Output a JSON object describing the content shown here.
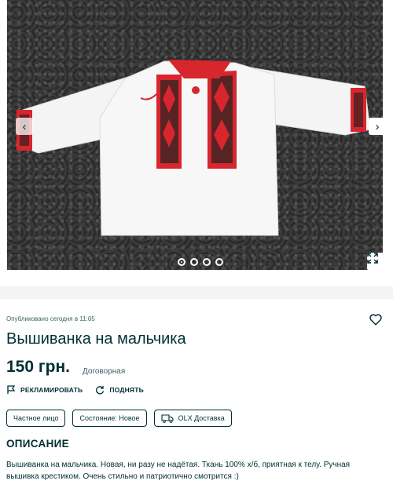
{
  "gallery": {
    "prev_label": "‹",
    "next_label": "›",
    "slide_count": 4,
    "active_slide": 1
  },
  "ad": {
    "published": "Опубликовано сегодня в 11:05",
    "title": "Вышиванка на мальчика",
    "price": "150 грн.",
    "negotiable": "Договорная"
  },
  "actions": {
    "promote_label": "РЕКЛАМИРОВАТЬ",
    "raise_label": "ПОДНЯТЬ"
  },
  "tags": {
    "seller_type": "Частное лицо",
    "condition": "Состояние: Новое",
    "delivery": "OLX Доставка"
  },
  "description": {
    "heading": "ОПИСАНИЕ",
    "text": "Вышиванка на мальчика. Новая, ни разу не надётая. Ткань 100% х/б, приятная к телу. Ручная вышивка крестиком. Очень стильно и патриотично смотрится :)"
  },
  "colors": {
    "text_primary": "#002f34",
    "embroidery_red": "#d7262e",
    "background_band": "#f2f4f5"
  }
}
